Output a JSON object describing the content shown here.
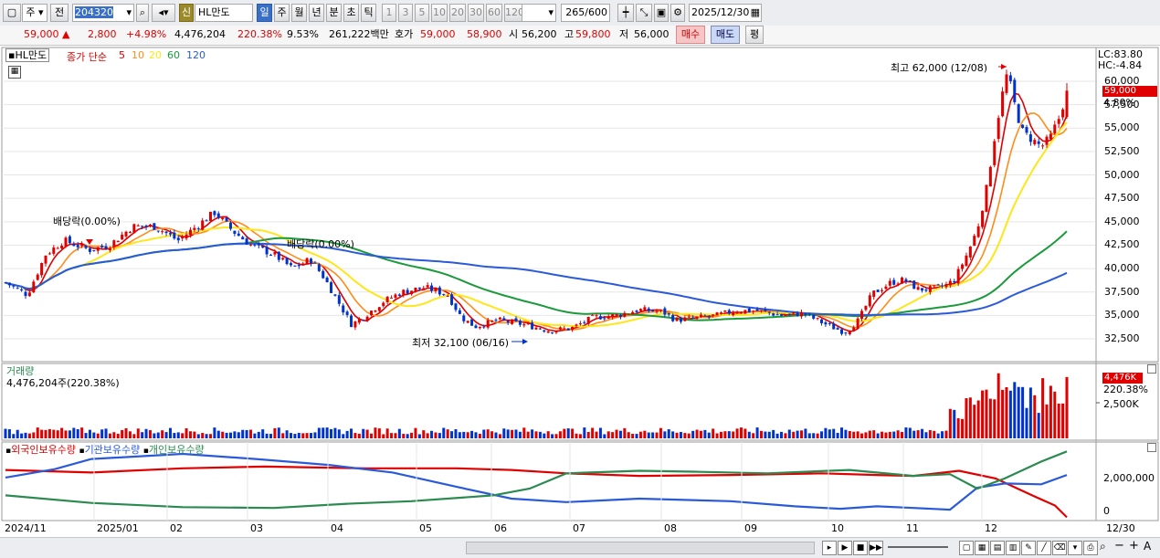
{
  "toolbar": {
    "market_label": "주",
    "prev_label": "전",
    "code_value": "204320",
    "sin_badge": "신",
    "name_value": "HL만도",
    "periods": [
      "일",
      "주",
      "월",
      "년",
      "분",
      "초",
      "틱"
    ],
    "active_period": "일",
    "intervals": [
      "1",
      "3",
      "5",
      "10",
      "20",
      "30",
      "60",
      "120"
    ],
    "count_value": "265",
    "count_total": "/600",
    "date_value": "2025/12/30"
  },
  "quote": {
    "price": "59,000",
    "change": "2,800",
    "change_pct": "+4.98%",
    "volume": "4,476,204",
    "volume_ratio": "220.38%",
    "turnover": "9.53%",
    "amount": "261,222백만",
    "hoga_label": "호가",
    "ask": "59,000",
    "bid": "58,900",
    "open_label": "시",
    "open": "56,200",
    "high_label": "고",
    "high": "59,800",
    "low_label": "저",
    "low": "56,000",
    "buy_label": "매수",
    "sell_label": "매도",
    "eval_label": "평"
  },
  "price_pane": {
    "stock_name": "HL만도",
    "ma_title": "종가 단순",
    "ma_periods": [
      "5",
      "10",
      "20",
      "60",
      "120"
    ],
    "lc_label": "LC:83.80",
    "hc_label": "HC:-4.84",
    "price_tag": "59,000",
    "pct_tag": "4.80%",
    "high_annotation": "최고 62,000 (12/08)",
    "low_annotation": "최저 32,100 (06/16)",
    "dividend_1": "배당락(0.00%)",
    "dividend_2": "배당락(0.00%)",
    "y_ticks": [
      "60,000",
      "57,500",
      "55,000",
      "52,500",
      "50,000",
      "47,500",
      "45,000",
      "42,500",
      "40,000",
      "37,500",
      "35,000",
      "32,500"
    ]
  },
  "volume_pane": {
    "title": "거래량",
    "value_text": "4,476,204주(220.38%)",
    "tag_volume": "4,476K",
    "tag_ratio": "220.38%",
    "y_tick": "2,500K"
  },
  "holding_pane": {
    "legend": [
      "외국인보유수량",
      "기관보유수량",
      "개인보유수량"
    ],
    "y_ticks": [
      "2,000,000",
      "0"
    ]
  },
  "x_axis": [
    "2024/11",
    "2025/01",
    "02",
    "03",
    "04",
    "05",
    "06",
    "07",
    "08",
    "09",
    "10",
    "11",
    "12",
    "12/30"
  ],
  "colors": {
    "up": "#e00000",
    "down": "#0033cc",
    "ma5": "#e00000",
    "ma10": "#ff8c1a",
    "ma20": "#ffe61a",
    "ma60": "#1a9a3a",
    "ma120": "#2a5ad8",
    "foreign": "#e00000",
    "institution": "#2a5ad8",
    "individual": "#2a8a50"
  }
}
